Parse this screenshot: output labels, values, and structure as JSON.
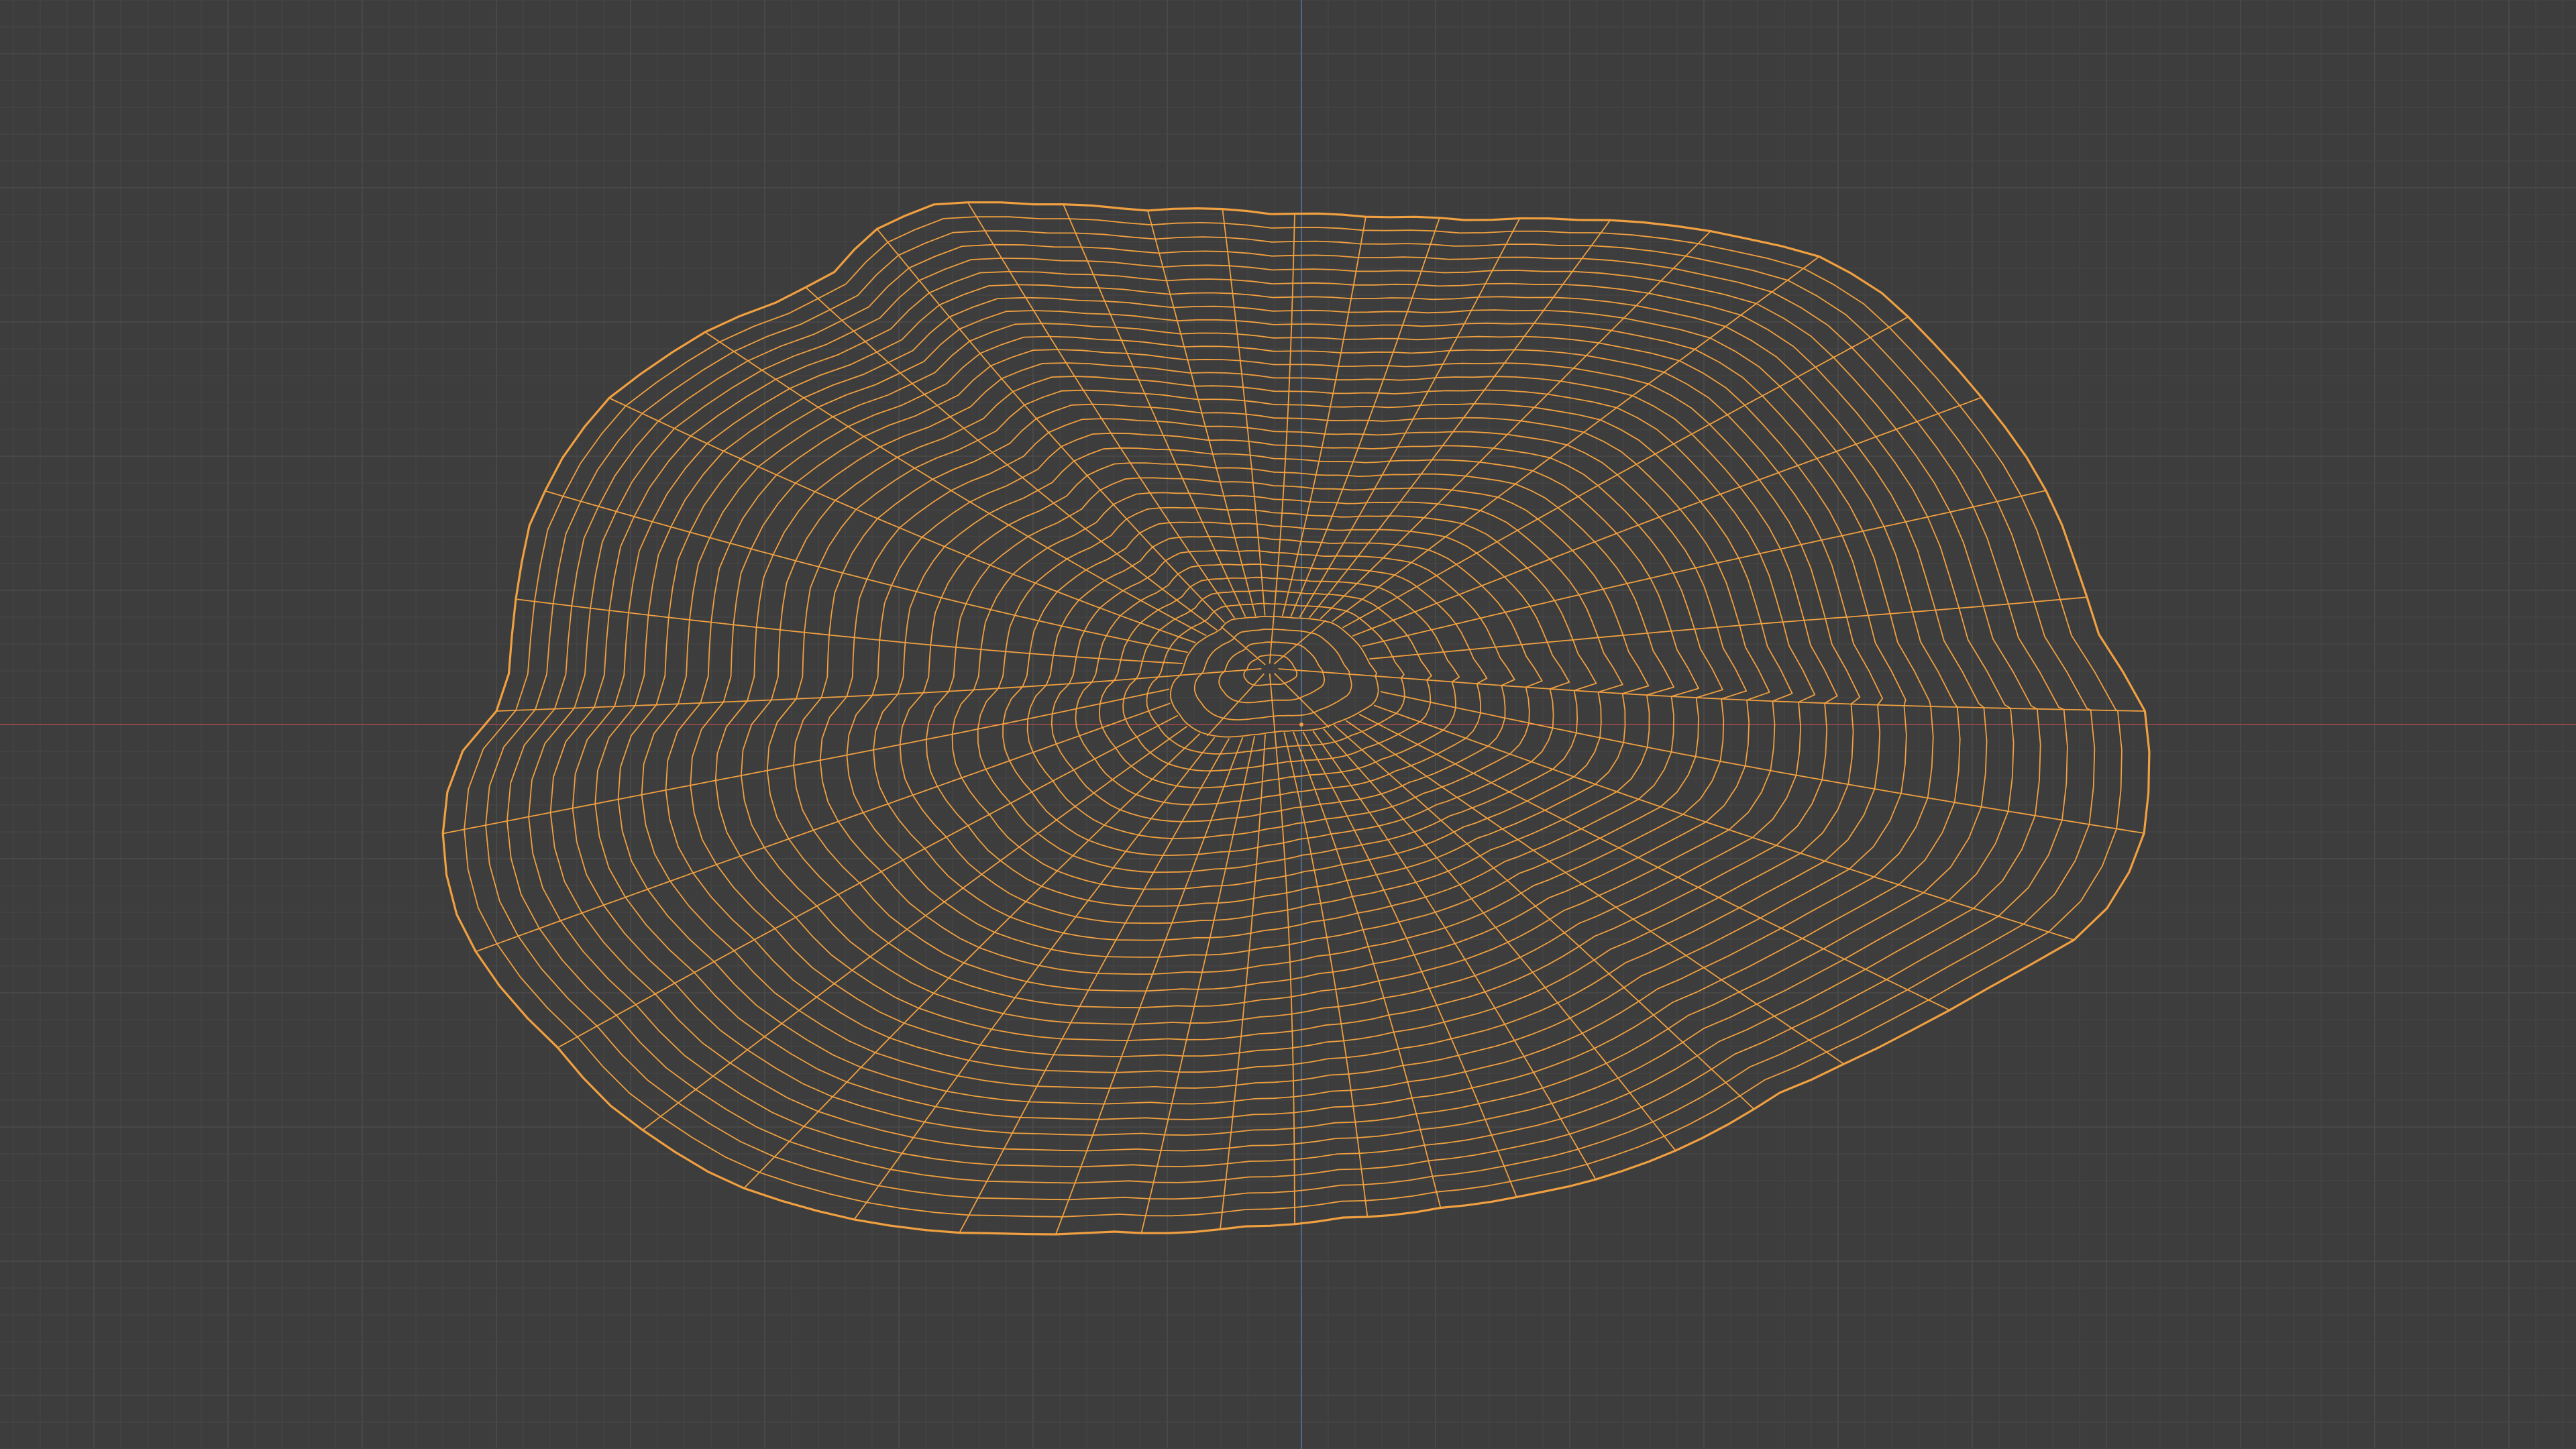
{
  "viewport": {
    "mode": "wireframe",
    "object": "sculpted-rock-mesh",
    "show_floor_grid": true,
    "show_axes": [
      "x",
      "y"
    ]
  },
  "colors": {
    "background": "#3d3d3d",
    "grid_minor": "#464646",
    "grid_major": "#4b4b4b",
    "axis_x": "#8f4646",
    "axis_y": "#4f6a86",
    "wire": "#f0a040",
    "wire_outline": "#f3a545",
    "origin": "#f0a040"
  }
}
